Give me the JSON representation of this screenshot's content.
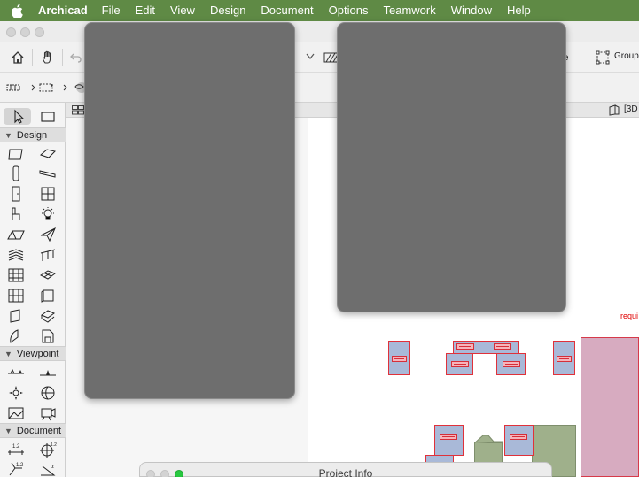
{
  "menubar": {
    "app_name": "Archicad",
    "items": [
      "File",
      "Edit",
      "View",
      "Design",
      "Document",
      "Options",
      "Teamwork",
      "Window",
      "Help"
    ]
  },
  "toolbar": {
    "measure_label": "sure",
    "groups_label": "Groups"
  },
  "tabbar": {
    "view_label": "[3D"
  },
  "toolbox": {
    "sections": [
      "Design",
      "Viewpoint",
      "Document"
    ]
  },
  "canvas": {
    "annotation": "requi"
  },
  "dialog": {
    "title": "Project Info"
  },
  "colors": {
    "menubar": "#5f8a45",
    "room_fill": "#a9b9d8",
    "room_stroke": "#e0313a",
    "overlay": "#6e6e6e"
  }
}
